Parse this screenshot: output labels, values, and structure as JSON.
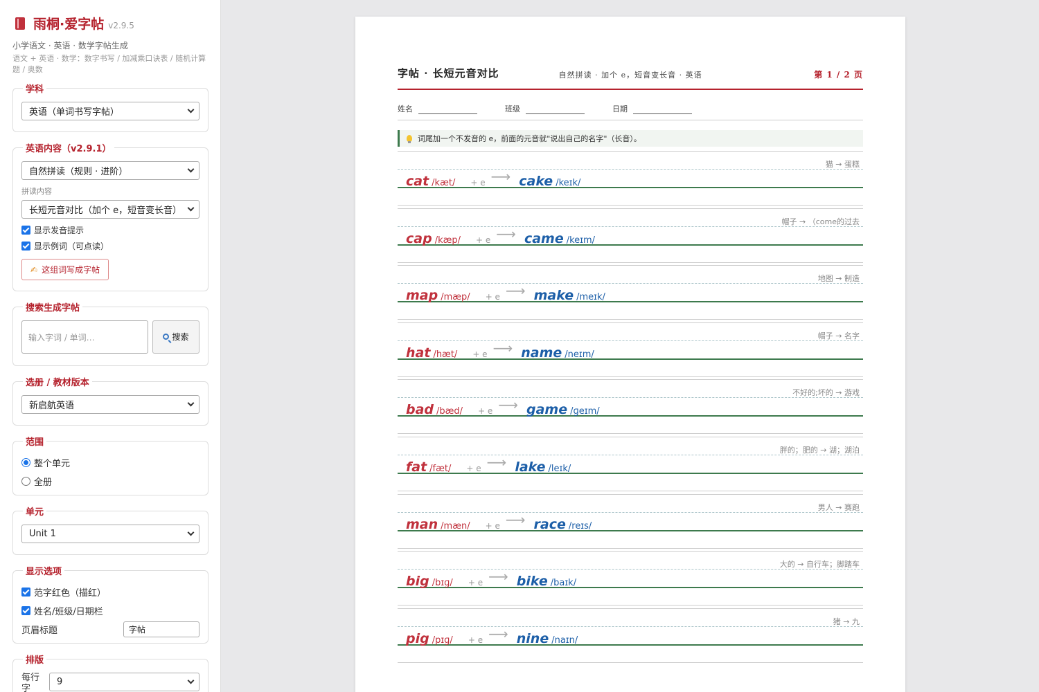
{
  "app": {
    "title": "雨桐·爱字帖",
    "version": "v2.9.5",
    "subtitle": "小学语文 · 英语 · 数学字帖生成",
    "subtitle2": "语文 + 英语 · 数学：数字书写 / 加减乘口诀表 / 随机计算题 / 奥数"
  },
  "panels": {
    "subject": {
      "legend": "学科",
      "value": "英语（单词书写字帖）"
    },
    "english": {
      "legend": "英语内容（v2.9.1）",
      "mode": "自然拼读（规则 · 进阶）",
      "phonics_label": "拼读内容",
      "phonics_value": "长短元音对比（加个 e，短音变长音）",
      "show_hint": "显示发音提示",
      "show_example": "显示例词（可点读）",
      "write_button": "这组词写成字帖"
    },
    "search": {
      "legend": "搜索生成字帖",
      "placeholder": "输入字词 / 单词…",
      "button": "搜索"
    },
    "book": {
      "legend": "选册 / 教材版本",
      "value": "新启航英语"
    },
    "range": {
      "legend": "范围",
      "options": [
        "整个单元",
        "全册"
      ],
      "selected": "整个单元"
    },
    "unit": {
      "legend": "单元",
      "value": "Unit 1"
    },
    "display": {
      "legend": "显示选项",
      "red_sample": "范字红色（描红）",
      "name_bar": "姓名/班级/日期栏",
      "header_label": "页眉标题",
      "header_value": "字帖"
    },
    "layout": {
      "legend": "排版",
      "per_row_label": "每行字",
      "per_row_value": "9"
    }
  },
  "sheet": {
    "title": "字帖 · 长短元音对比",
    "meta": "自然拼读 · 加个 e，短音变长音 · 英语",
    "page": "第 1 / 2 页",
    "name_label": "姓名",
    "class_label": "班级",
    "date_label": "日期",
    "tip": "词尾加一个不发音的 e，前面的元音就\"说出自己的名字\"（长音）。",
    "plus_e": "+ e",
    "arrow": "⟶",
    "rows": [
      {
        "short": "cat",
        "short_ipa": "/kæt/",
        "long": "cake",
        "long_ipa": "/keɪk/",
        "gloss": "猫 → 蛋糕"
      },
      {
        "short": "cap",
        "short_ipa": "/kæp/",
        "long": "came",
        "long_ipa": "/keɪm/",
        "gloss": "帽子 → （come的过去"
      },
      {
        "short": "map",
        "short_ipa": "/mæp/",
        "long": "make",
        "long_ipa": "/meɪk/",
        "gloss": "地图 → 制造"
      },
      {
        "short": "hat",
        "short_ipa": "/hæt/",
        "long": "name",
        "long_ipa": "/neɪm/",
        "gloss": "帽子 → 名字"
      },
      {
        "short": "bad",
        "short_ipa": "/bæd/",
        "long": "game",
        "long_ipa": "/ɡeɪm/",
        "gloss": "不好的;坏的 → 游戏"
      },
      {
        "short": "fat",
        "short_ipa": "/fæt/",
        "long": "lake",
        "long_ipa": "/leɪk/",
        "gloss": "胖的；肥的 → 湖；湖泊"
      },
      {
        "short": "man",
        "short_ipa": "/mæn/",
        "long": "race",
        "long_ipa": "/reɪs/",
        "gloss": "男人 → 赛跑"
      },
      {
        "short": "big",
        "short_ipa": "/bɪɡ/",
        "long": "bike",
        "long_ipa": "/baɪk/",
        "gloss": "大的 → 自行车；脚踏车"
      },
      {
        "short": "pig",
        "short_ipa": "/pɪɡ/",
        "long": "nine",
        "long_ipa": "/naɪn/",
        "gloss": "猪 → 九"
      }
    ]
  },
  "colors": {
    "accent": "#b5222d",
    "short_word": "#c0313c",
    "long_word": "#1d5fa8",
    "baseline": "#3d7a4d"
  }
}
